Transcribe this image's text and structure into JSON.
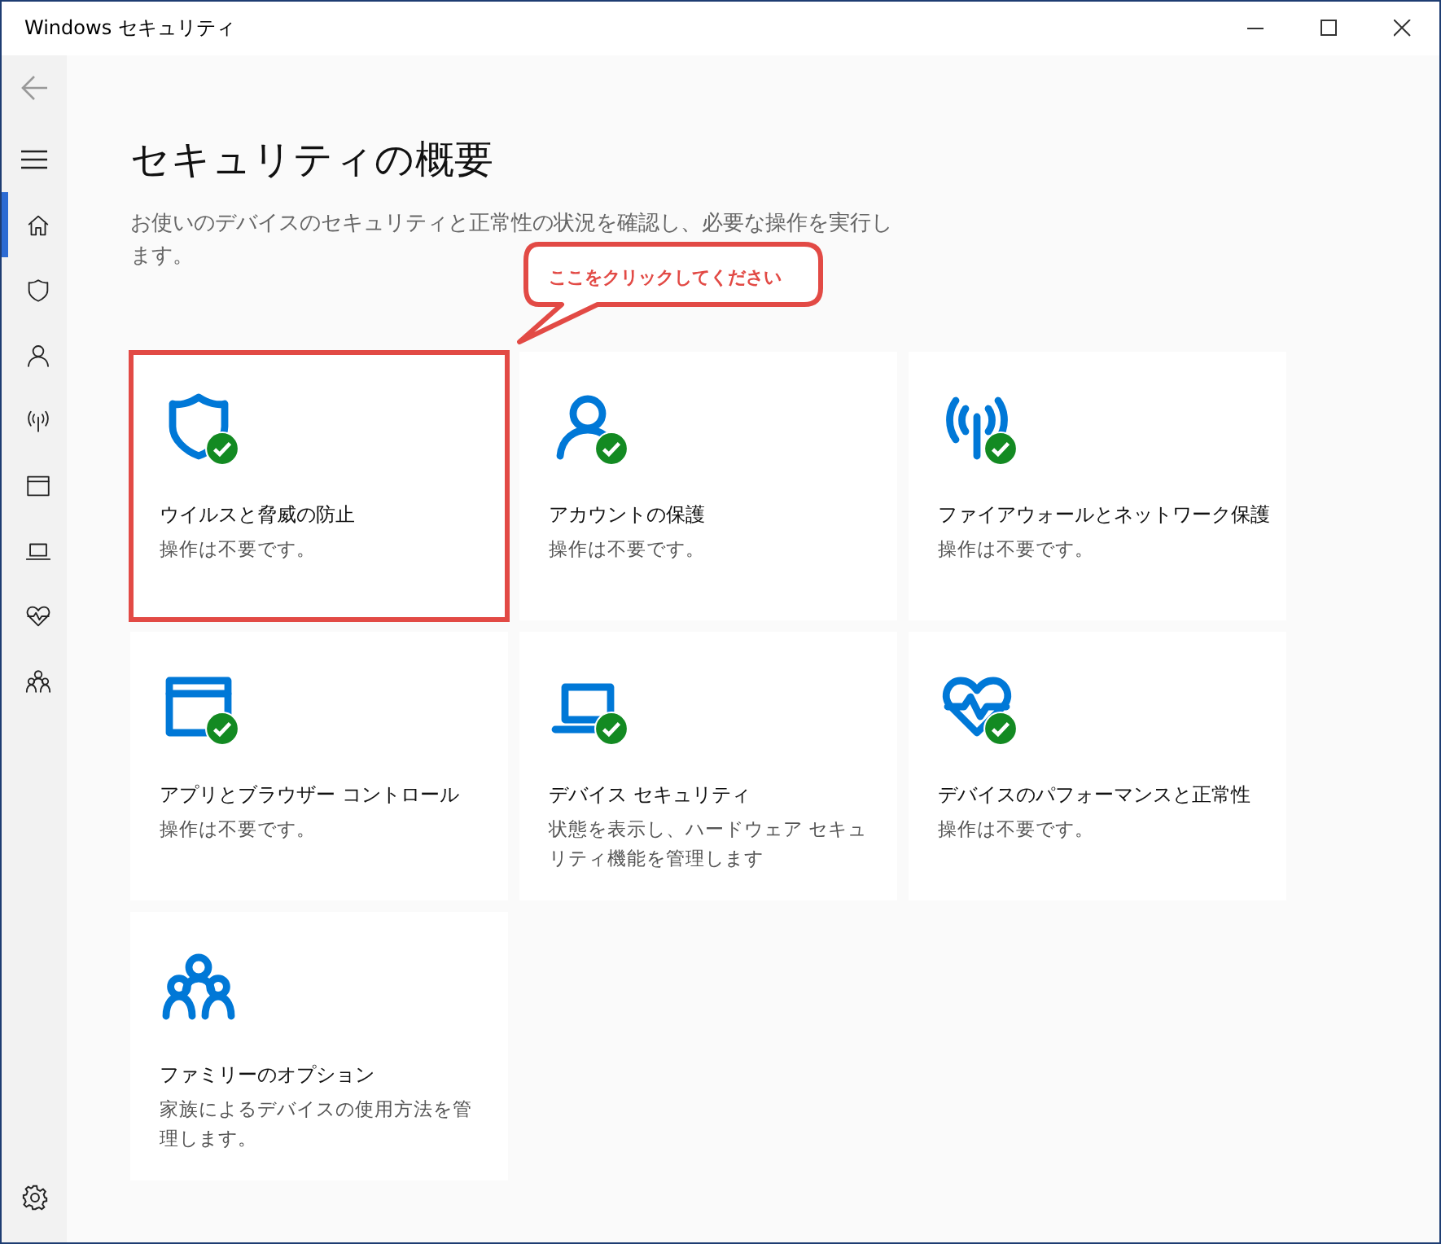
{
  "window": {
    "title": "Windows セキュリティ"
  },
  "sidebar": {
    "items": [
      {
        "kind": "home",
        "selected": true
      },
      {
        "kind": "shield",
        "selected": false
      },
      {
        "kind": "person",
        "selected": false
      },
      {
        "kind": "wireless",
        "selected": false
      },
      {
        "kind": "browser",
        "selected": false
      },
      {
        "kind": "laptop",
        "selected": false
      },
      {
        "kind": "heart",
        "selected": false
      },
      {
        "kind": "family",
        "selected": false
      }
    ]
  },
  "page": {
    "title": "セキュリティの概要",
    "description": "お使いのデバイスのセキュリティと正常性の状況を確認し、必要な操作を実行します。"
  },
  "cards": [
    {
      "kind": "shield",
      "title": "ウイルスと脅威の防止",
      "status": "操作は不要です。",
      "ok": true,
      "highlighted": true
    },
    {
      "kind": "person",
      "title": "アカウントの保護",
      "status": "操作は不要です。",
      "ok": true,
      "highlighted": false
    },
    {
      "kind": "wireless",
      "title": "ファイアウォールとネットワーク保護",
      "status": "操作は不要です。",
      "ok": true,
      "highlighted": false
    },
    {
      "kind": "browser",
      "title": "アプリとブラウザー コントロール",
      "status": "操作は不要です。",
      "ok": true,
      "highlighted": false
    },
    {
      "kind": "laptop",
      "title": "デバイス セキュリティ",
      "status": "状態を表示し、ハードウェア セキュリティ機能を管理します",
      "ok": true,
      "highlighted": false
    },
    {
      "kind": "heart",
      "title": "デバイスのパフォーマンスと正常性",
      "status": "操作は不要です。",
      "ok": true,
      "highlighted": false
    },
    {
      "kind": "family",
      "title": "ファミリーのオプション",
      "status": "家族によるデバイスの使用方法を管理します。",
      "ok": false,
      "highlighted": false
    }
  ],
  "callout": {
    "text": "ここをクリックしてください"
  }
}
